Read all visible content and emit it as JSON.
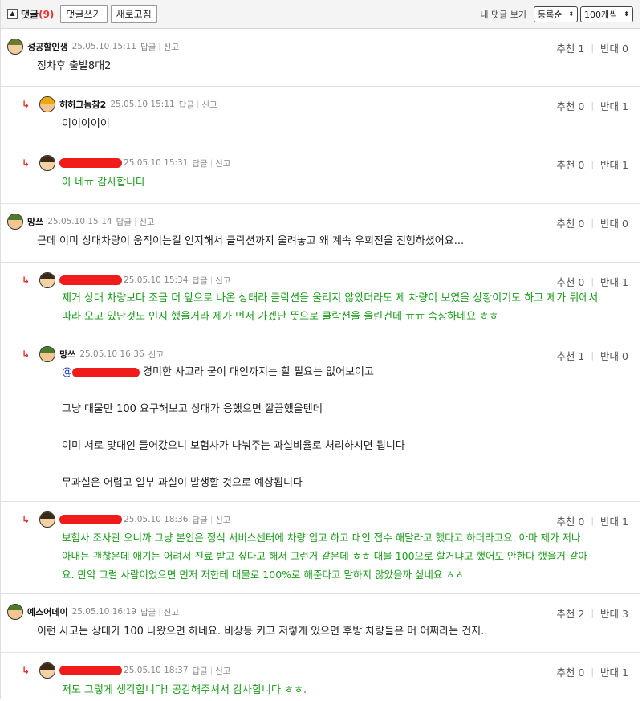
{
  "header": {
    "toggle_icon": "▲",
    "title": "댓글",
    "count": "(9)",
    "write_button": "댓글쓰기",
    "refresh_button": "새로고침",
    "my_comments": "내 댓글 보기",
    "sort_select": "등록순",
    "per_page_select": "100개씩"
  },
  "labels": {
    "reply": "답글",
    "report": "신고",
    "recommend": "추천",
    "oppose": "반대"
  },
  "comments": [
    {
      "nick": "성공할인생",
      "date": "25.05.10 15:11",
      "text": "정차후 출발8대2",
      "up": "1",
      "down": "0"
    },
    {
      "nick": "허허그놈참2",
      "date": "25.05.10 15:11",
      "text": "이이이이이",
      "up": "0",
      "down": "1"
    },
    {
      "nick": "",
      "date": "25.05.10 15:31",
      "text": "아 네ㅠ 감사합니다",
      "up": "0",
      "down": "1"
    },
    {
      "nick": "망쓰",
      "date": "25.05.10 15:14",
      "text": "근데 이미 상대차량이 움직이는걸 인지해서 클락션까지 울려놓고 왜 계속 우회전을 진행하셨어요...",
      "up": "0",
      "down": "0"
    },
    {
      "nick": "",
      "date": "25.05.10 15:34",
      "text_lines": [
        "제거 상대 차량보다 조금 더 앞으로 나온 상태라 클락션을 울리지 않았더라도 제 차량이 보였을 상황이기도 하고 제가 뒤에서",
        "따라 오고 있단것도 인지 했을거라 제가 먼저 가겠단 뜻으로 클락션을 울린건데 ㅠㅠ 속상하네요 ㅎㅎ"
      ],
      "up": "0",
      "down": "1"
    },
    {
      "nick": "망쓰",
      "date": "25.05.10 16:36",
      "mention": "@",
      "text_lines": [
        "경미한 사고라 굳이 대인까지는 할 필요는 없어보이고",
        "그냥 대물만 100 요구해보고 상대가 응했으면 깔끔했을텐데",
        "이미 서로 맞대인 들어갔으니 보험사가 나눠주는 과실비율로 처리하시면 됩니다",
        "무과실은 어렵고 일부 과실이 발생할 것으로 예상됩니다"
      ],
      "up": "1",
      "down": "0"
    },
    {
      "nick": "",
      "date": "25.05.10 18:36",
      "text_lines": [
        "보험사 조사관 오니까 그냥 본인은 정식 서비스센터에 차량 입고 하고 대인 접수 해달라고 했다고 하더라고요. 아마 제가 저나",
        "아내는 괜찮은데 애기는 어려서 진료 받고 싶다고 해서 그런거 같은데 ㅎㅎ 대물 100으로 할거냐고 했어도 안한다 했을거 같아",
        "요. 만약 그럴 사람이었으면 먼저 저한테 대물로 100%로 해준다고 말하지 않았을까 싶네요 ㅎㅎ"
      ],
      "up": "0",
      "down": "1"
    },
    {
      "nick": "예스어데이",
      "date": "25.05.10 16:19",
      "text": "이런 사고는 상대가 100 나왔으면 하네요. 비상등 키고 저렇게 있으면 후방 차량들은 머 어쩌라는 건지..",
      "up": "2",
      "down": "3"
    },
    {
      "nick": "",
      "date": "25.05.10 18:37",
      "text": "저도 그렇게 생각합니다! 공감해주셔서 감사합니다 ㅎㅎ.",
      "up": "0",
      "down": "1"
    }
  ],
  "icons": {
    "reply_arrow": "↳",
    "select_arrow": "⬍"
  }
}
